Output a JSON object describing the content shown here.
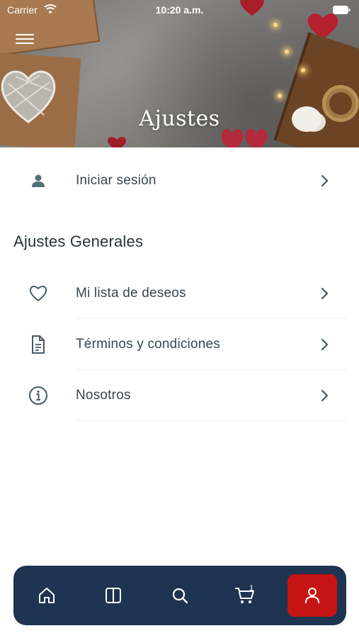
{
  "status_bar": {
    "carrier": "Carrier",
    "time": "10:20 a.m."
  },
  "header": {
    "title": "Ajustes",
    "menu_icon": "hamburger-menu-icon"
  },
  "login_row": {
    "label": "Iniciar sesión",
    "icon": "person-icon"
  },
  "general_section": {
    "title": "Ajustes Generales",
    "items": [
      {
        "label": "Mi lista de deseos",
        "icon": "heart-icon"
      },
      {
        "label": "Términos y condiciones",
        "icon": "document-icon"
      },
      {
        "label": "Nosotros",
        "icon": "info-icon"
      }
    ]
  },
  "tab_bar": {
    "items": [
      {
        "name": "home",
        "icon": "home-icon"
      },
      {
        "name": "catalog",
        "icon": "book-icon"
      },
      {
        "name": "search",
        "icon": "search-icon"
      },
      {
        "name": "cart",
        "icon": "cart-icon",
        "badge": "1"
      },
      {
        "name": "profile",
        "icon": "person-icon",
        "active": true
      }
    ]
  },
  "colors": {
    "tab_bar_bg": "#1e3450",
    "active_tab_bg": "#c51414",
    "icon_color": "#455a64"
  }
}
